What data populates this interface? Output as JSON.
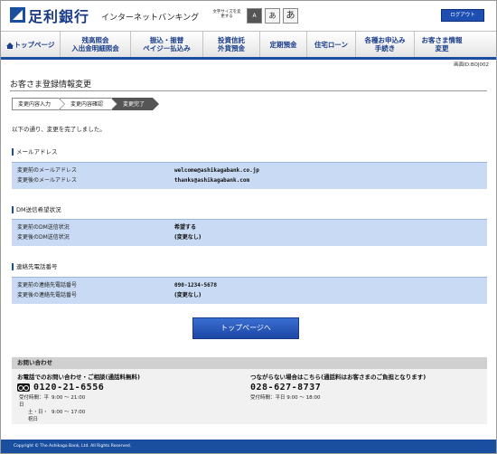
{
  "header": {
    "bank_name": "足利銀行",
    "service_name": "インターネットバンキング",
    "fontsize_label": "文字サイズを変更する",
    "fontsize_buttons": [
      "A",
      "あ",
      "あ"
    ],
    "logout_label": "ログアウト"
  },
  "nav": {
    "items": [
      {
        "label": "トップページ"
      },
      {
        "label": "残高照会\n入出金明細照会"
      },
      {
        "label": "振込・振替\nペイジー払込み"
      },
      {
        "label": "投資信託\n外貨預金"
      },
      {
        "label": "定期預金"
      },
      {
        "label": "住宅ローン"
      },
      {
        "label": "各種お申込み\n手続き"
      },
      {
        "label": "お客さま情報\n変更"
      }
    ]
  },
  "screen_id": "画面ID:BOJ002",
  "page_title": "お客さま登録情報変更",
  "steps": [
    "変更内容入力",
    "変更内容確認",
    "変更完了"
  ],
  "complete_message": "以下の通り、変更を完了しました。",
  "sections": {
    "email": {
      "title": "メールアドレス",
      "before_label": "変更前のメールアドレス",
      "before_value": "welcome@ashikagabank.co.jp",
      "after_label": "変更後のメールアドレス",
      "after_value": "thanks@ashikagabank.com"
    },
    "dm": {
      "title": "DM送信希望状況",
      "before_label": "変更前のDM送信状況",
      "before_value": "希望する",
      "after_label": "変更後のDM送信状況",
      "after_value": "(変更なし)"
    },
    "phone": {
      "title": "連絡先電話番号",
      "before_label": "変更前の連絡先電話番号",
      "before_value": "090-1234-5678",
      "after_label": "変更後の連絡先電話番号",
      "after_value": "(変更なし)"
    }
  },
  "top_button_label": "トップページへ",
  "contact": {
    "heading": "お問い合わせ",
    "left_lead": "お電話でのお問い合わせ・ご相談(通話料無料)",
    "left_phone": "0120-21-6556",
    "left_hours": [
      [
        "受付時間：平日",
        "9:00 ～ 21:00"
      ],
      [
        "土・日・祝日",
        "9:00 ～ 17:00"
      ]
    ],
    "right_lead": "つながらない場合はこちら(通話料はお客さまのご負担となります)",
    "right_phone": "028-627-8737",
    "right_hours": "受付時間：平日 9:00 ～ 18:00"
  },
  "footer": "Copyright © The Ashikaga Bank, Ltd. All Rights Reserved."
}
